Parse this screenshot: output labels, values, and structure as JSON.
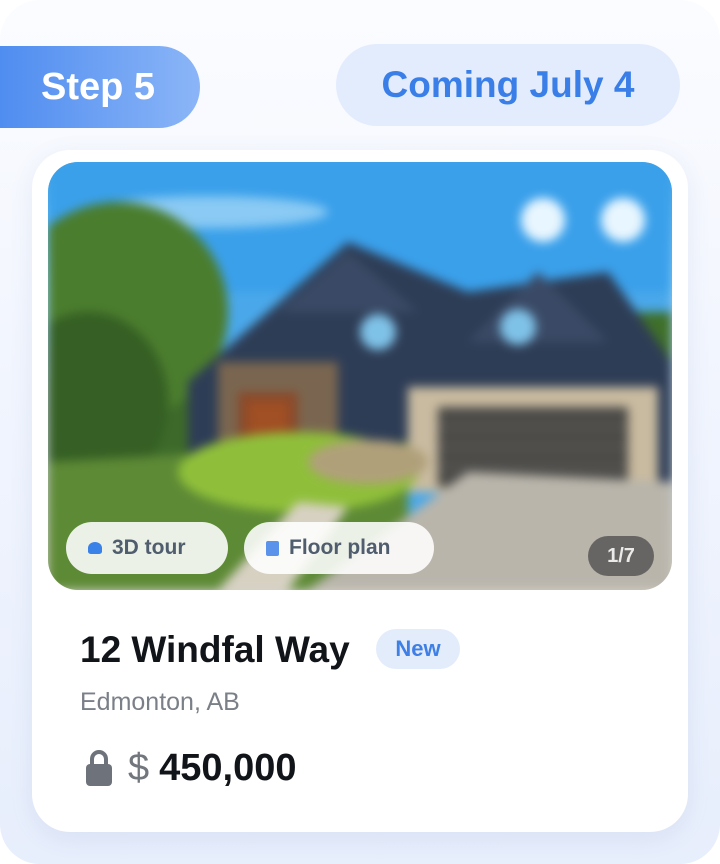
{
  "step": {
    "label": "Step 5"
  },
  "availability": {
    "label": "Coming July 4"
  },
  "listing": {
    "photo": {
      "alt": "House exterior photo",
      "chips": [
        {
          "label": "3D tour",
          "icon": "cube-icon"
        },
        {
          "label": "Floor plan",
          "icon": "floor-plan-icon"
        }
      ],
      "counter": "1/7"
    },
    "address": "12 Windfal Way",
    "badge": "New",
    "location": "Edmonton, AB",
    "price": {
      "currency": "$",
      "amount": "450,000",
      "icon": "lock-icon"
    }
  },
  "colors": {
    "accent": "#3a7ee8",
    "badge_bg": "#e3ecfd",
    "step_gradient_start": "#4f8df0",
    "step_gradient_end": "#8bb5f7"
  }
}
